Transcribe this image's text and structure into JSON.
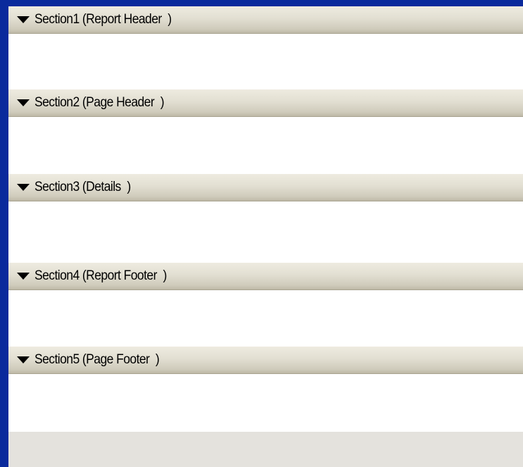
{
  "sections": [
    {
      "label": "Section1 (Report Header  )",
      "icon": "triangle-down-icon"
    },
    {
      "label": "Section2 (Page Header  )",
      "icon": "triangle-down-icon"
    },
    {
      "label": "Section3 (Details  )",
      "icon": "triangle-down-icon"
    },
    {
      "label": "Section4 (Report Footer  )",
      "icon": "triangle-down-icon"
    },
    {
      "label": "Section5 (Page Footer  )",
      "icon": "triangle-down-icon"
    }
  ],
  "colors": {
    "background": "#0a2a9c",
    "band_header": "#e2dfd2",
    "band_body": "#ffffff",
    "empty_area": "#e4e2dd"
  }
}
